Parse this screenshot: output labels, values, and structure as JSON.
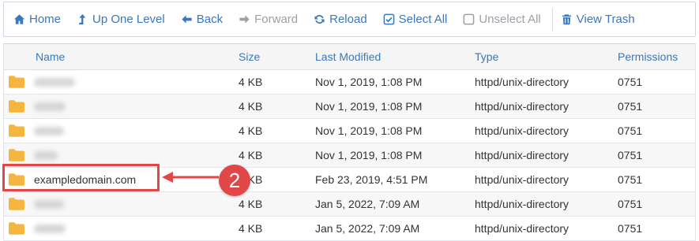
{
  "toolbar": {
    "home": "Home",
    "up_one_level": "Up One Level",
    "back": "Back",
    "forward": "Forward",
    "reload": "Reload",
    "select_all": "Select All",
    "unselect_all": "Unselect All",
    "view_trash": "View Trash"
  },
  "table": {
    "headers": {
      "name": "Name",
      "size": "Size",
      "last_modified": "Last Modified",
      "type": "Type",
      "permissions": "Permissions"
    },
    "rows": [
      {
        "name": "",
        "size": "4 KB",
        "modified": "Nov 1, 2019, 1:08 PM",
        "type": "httpd/unix-directory",
        "perms": "0751"
      },
      {
        "name": "",
        "size": "4 KB",
        "modified": "Nov 1, 2019, 1:08 PM",
        "type": "httpd/unix-directory",
        "perms": "0751"
      },
      {
        "name": "",
        "size": "4 KB",
        "modified": "Nov 1, 2019, 1:08 PM",
        "type": "httpd/unix-directory",
        "perms": "0751"
      },
      {
        "name": "",
        "size": "4 KB",
        "modified": "Nov 1, 2019, 1:08 PM",
        "type": "httpd/unix-directory",
        "perms": "0751"
      },
      {
        "name": "exampledomain.com",
        "size": "4 KB",
        "modified": "Feb 23, 2019, 4:51 PM",
        "type": "httpd/unix-directory",
        "perms": "0751"
      },
      {
        "name": "",
        "size": "4 KB",
        "modified": "Jan 5, 2022, 7:09 AM",
        "type": "httpd/unix-directory",
        "perms": "0751"
      },
      {
        "name": "",
        "size": "4 KB",
        "modified": "Jan 5, 2022, 7:09 AM",
        "type": "httpd/unix-directory",
        "perms": "0751"
      }
    ]
  },
  "annotation": {
    "step_number": "2",
    "accent_color": "#e14747"
  },
  "colors": {
    "link_blue": "#3a77bd",
    "folder_yellow": "#f4b63f",
    "disabled_gray": "#9aa0a6"
  }
}
